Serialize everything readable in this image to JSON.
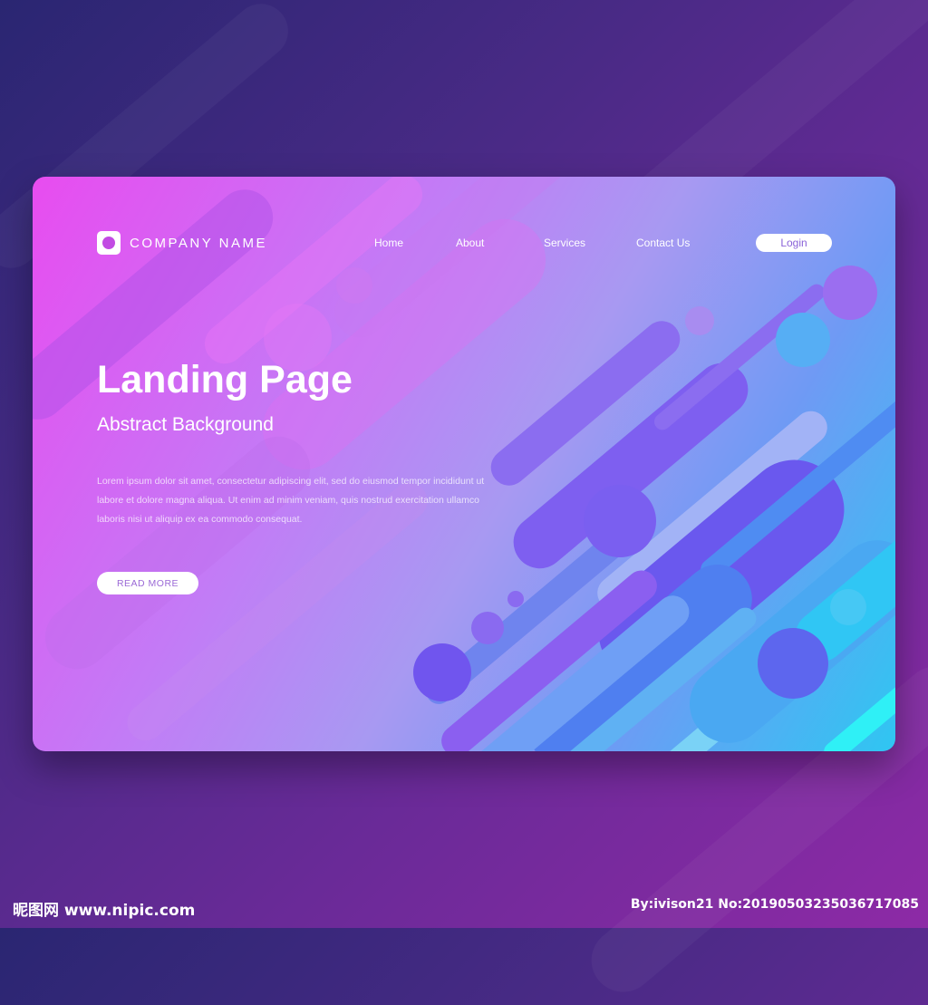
{
  "header": {
    "company_name": "COMPANY NAME",
    "nav": [
      "Home",
      "About",
      "Services",
      "Contact Us"
    ],
    "login_label": "Login"
  },
  "hero": {
    "title": "Landing Page",
    "subtitle": "Abstract Background",
    "body": "Lorem ipsum dolor sit amet, consectetur adipiscing elit, sed do eiusmod tempor incididunt ut labore et dolore magna aliqua. Ut enim ad minim veniam, quis nostrud exercitation ullamco laboris nisi ut aliquip ex ea commodo consequat.",
    "read_more_label": "READ MORE"
  },
  "watermark": {
    "left": "昵图网 www.nipic.com",
    "right": "By:ivison21 No:20190503235036717085"
  },
  "colors": {
    "accent_pink": "#e84cf0",
    "accent_cyan": "#2fc6f2",
    "button_text": "#9b6ad6"
  },
  "icons": {
    "logo": "rounded-square-circle-icon"
  }
}
